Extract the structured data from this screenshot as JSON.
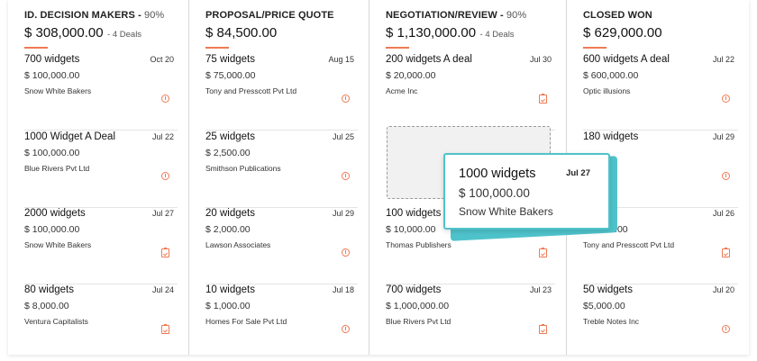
{
  "accent_color": "#ef7a54",
  "drag_color": "#4fc3cb",
  "columns": [
    {
      "stage": "ID. DECISION MAKERS -",
      "percent": "90%",
      "total": "$ 308,000.00",
      "deals": "- 4 Deals",
      "cards": [
        {
          "title": "700 widgets",
          "date": "Oct 20",
          "amount": "$ 100,000.00",
          "company": "Snow White Bakers",
          "icon": "clock-icon"
        },
        {
          "title": "1000 Widget A Deal",
          "date": "Jul 22",
          "amount": "$ 100,000.00",
          "company": "Blue Rivers Pvt Ltd",
          "icon": "clock-icon"
        },
        {
          "title": "2000 widgets",
          "date": "Jul 27",
          "amount": "$ 100,000.00",
          "company": "Snow White Bakers",
          "icon": "task-icon"
        },
        {
          "title": "80 widgets",
          "date": "Jul 24",
          "amount": "$ 8,000.00",
          "company": "Ventura Capitalists",
          "icon": "task-icon"
        }
      ]
    },
    {
      "stage": "PROPOSAL/PRICE QUOTE",
      "percent": "",
      "total": "$ 84,500.00",
      "deals": "",
      "cards": [
        {
          "title": "75 widgets",
          "date": "Aug 15",
          "amount": "$ 75,000.00",
          "company": "Tony and Presscott Pvt Ltd",
          "icon": "clock-icon"
        },
        {
          "title": "25 widgets",
          "date": "Jul 25",
          "amount": "$ 2,500.00",
          "company": "Smithson Publications",
          "icon": "clock-icon"
        },
        {
          "title": "20 widgets",
          "date": "Jul 29",
          "amount": "$ 2,000.00",
          "company": "Lawson Associates",
          "icon": "clock-icon"
        },
        {
          "title": "10 widgets",
          "date": "Jul 18",
          "amount": "$ 1,000.00",
          "company": "Homes For Sale Pvt Ltd",
          "icon": "clock-icon"
        }
      ]
    },
    {
      "stage": "NEGOTIATION/REVIEW -",
      "percent": "90%",
      "total": "$ 1,130,000.00",
      "deals": "- 4 Deals",
      "cards": [
        {
          "title": "200 widgets A deal",
          "date": "Jul 30",
          "amount": "$ 20,000.00",
          "company": "Acme Inc",
          "icon": "task-icon"
        },
        null,
        {
          "title": "100 widgets",
          "date": "",
          "amount": "$ 10,000.00",
          "company": "Thomas Publishers",
          "icon": "task-icon"
        },
        {
          "title": "700 widgets",
          "date": "Jul 23",
          "amount": "$ 1,000,000.00",
          "company": "Blue Rivers Pvt Ltd",
          "icon": "task-icon"
        }
      ]
    },
    {
      "stage": "CLOSED WON",
      "percent": "",
      "total": "$ 629,000.00",
      "deals": "",
      "cards": [
        {
          "title": "600 widgets A deal",
          "date": "Jul 22",
          "amount": "$ 600,000.00",
          "company": "Optic illusions",
          "icon": "clock-icon"
        },
        {
          "title": "180 widgets",
          "date": "Jul 29",
          "amount": "",
          "company": "",
          "icon": "clock-icon"
        },
        {
          "title": "",
          "date": "Jul 26",
          "amount": "$ 6,000.00",
          "company": "Tony and Presscott Pvt Ltd",
          "icon": "task-icon"
        },
        {
          "title": "50 widgets",
          "date": "Jul 20",
          "amount": "$5,000.00",
          "company": "Treble Notes Inc",
          "icon": "clock-icon"
        }
      ]
    }
  ],
  "dragged_card": {
    "title": "1000 widgets",
    "date": "Jul 27",
    "amount": "$ 100,000.00",
    "company": "Snow White Bakers"
  }
}
